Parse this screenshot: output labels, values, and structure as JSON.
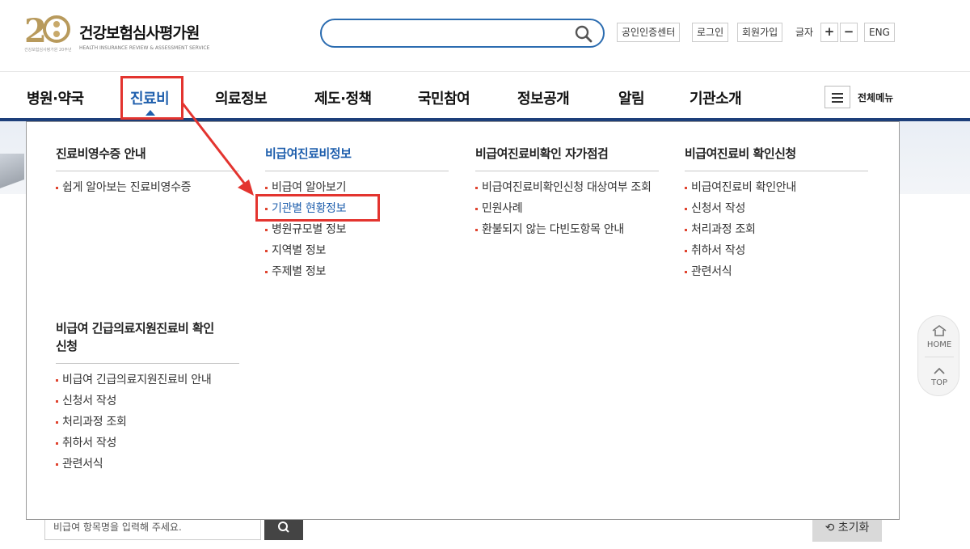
{
  "header": {
    "logo_main": "건강보험심사평가원",
    "logo_sub": "HEALTH INSURANCE REVIEW & ASSESSMENT SERVICE",
    "logo_tiny": "건강보험심사평가원 20주년",
    "search_placeholder": "",
    "utils": [
      "공인인증센터",
      "로그인",
      "회원가입"
    ],
    "font_size_label": "글자",
    "font_plus": "+",
    "font_minus": "−",
    "lang": "ENG"
  },
  "gnb": {
    "items": [
      "병원·약국",
      "진료비",
      "의료정보",
      "제도·정책",
      "국민참여",
      "정보공개",
      "알림",
      "기관소개"
    ],
    "active_index": 1,
    "all_menu_label": "전체메뉴"
  },
  "mega": {
    "columns": [
      {
        "title": "진료비영수증 안내",
        "links": [
          "쉽게 알아보는 진료비영수증"
        ]
      },
      {
        "title": "비급여진료비정보",
        "links": [
          "비급여 알아보기",
          "기관별 현황정보",
          "병원규모별 정보",
          "지역별 정보",
          "주제별 정보"
        ]
      },
      {
        "title": "비급여진료비확인 자가점검",
        "links": [
          "비급여진료비확인신청 대상여부 조회",
          "민원사례",
          "환불되지 않는 다빈도항목 안내"
        ]
      },
      {
        "title": "비급여진료비 확인신청",
        "links": [
          "비급여진료비 확인안내",
          "신청서 작성",
          "처리과정 조회",
          "취하서 작성",
          "관련서식"
        ]
      },
      {
        "title": "비급여 긴급의료지원진료비 확인신청",
        "links": [
          "비급여 긴급의료지원진료비 안내",
          "신청서 작성",
          "처리과정 조회",
          "취하서 작성",
          "관련서식"
        ]
      }
    ]
  },
  "page": {
    "bottom_input_text": "비급여 항목명을 입력해 주세요.",
    "reset_label": "초기화"
  },
  "quick": {
    "home": "HOME",
    "top": "TOP"
  },
  "colors": {
    "accent": "#1f5fad",
    "annotation": "#e3342f",
    "nav_bar": "#1d3f7a"
  }
}
